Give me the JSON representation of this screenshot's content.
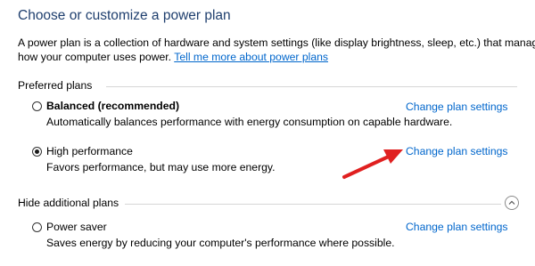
{
  "header": {
    "title": "Choose or customize a power plan",
    "intro_text": "A power plan is a collection of hardware and system settings (like display brightness, sleep, etc.) that manages",
    "intro_text_line2": "how your computer uses power.",
    "intro_link": "Tell me more about power plans"
  },
  "preferred_plans": {
    "header": "Preferred plans",
    "plans": [
      {
        "name": "Balanced (recommended)",
        "description": "Automatically balances performance with energy consumption on capable hardware.",
        "link": "Change plan settings",
        "selected": false
      },
      {
        "name": "High performance",
        "description": "Favors performance, but may use more energy.",
        "link": "Change plan settings",
        "selected": true
      }
    ]
  },
  "additional_plans": {
    "header": "Hide additional plans",
    "plans": [
      {
        "name": "Power saver",
        "description": "Saves energy by reducing your computer's performance where possible.",
        "link": "Change plan settings",
        "selected": false
      }
    ]
  },
  "colors": {
    "title": "#1f3f6e",
    "link": "#0066cc",
    "annotation_arrow": "#e02020"
  },
  "icons": {
    "collapse": "chevron-up-icon",
    "annotation": "red-arrow-icon"
  }
}
